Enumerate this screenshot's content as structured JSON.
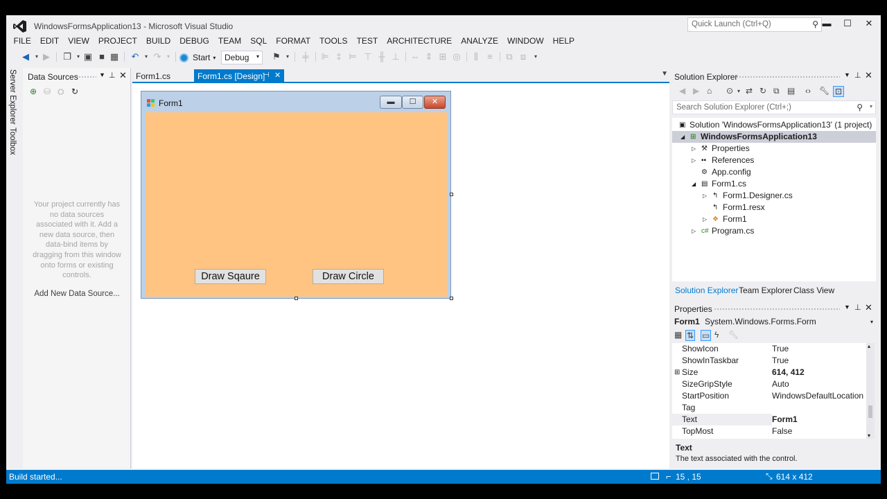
{
  "window": {
    "title": "WindowsFormsApplication13 - Microsoft Visual Studio",
    "quick_launch_placeholder": "Quick Launch (Ctrl+Q)",
    "minimize": "▬",
    "maximize": "☐",
    "close": "✕"
  },
  "menu": [
    "FILE",
    "EDIT",
    "VIEW",
    "PROJECT",
    "BUILD",
    "DEBUG",
    "TEAM",
    "SQL",
    "FORMAT",
    "TOOLS",
    "TEST",
    "ARCHITECTURE",
    "ANALYZE",
    "WINDOW",
    "HELP"
  ],
  "toolbar": {
    "start_label": "Start",
    "config_value": "Debug"
  },
  "left_strip": {
    "server_explorer": "Server Explorer",
    "toolbox": "Toolbox"
  },
  "data_sources": {
    "title": "Data Sources",
    "empty_message": "Your project currently has no data sources associated with it. Add a new data source, then data-bind items by dragging from this window onto forms or existing controls.",
    "add_link": "Add New Data Source..."
  },
  "doc_tabs": {
    "tab1": "Form1.cs",
    "tab2": "Form1.cs [Design]"
  },
  "form": {
    "title": "Form1",
    "button1": "Draw Sqaure",
    "button2": "Draw Circle",
    "back_color": "#ffc482"
  },
  "solution_explorer": {
    "title": "Solution Explorer",
    "search_placeholder": "Search Solution Explorer (Ctrl+;)",
    "tree": [
      {
        "label": "Solution 'WindowsFormsApplication13' (1 project)",
        "icon": "solution-icon"
      },
      {
        "label": "WindowsFormsApplication13",
        "icon": "csharp-project-icon"
      },
      {
        "label": "Properties",
        "icon": "wrench-icon"
      },
      {
        "label": "References",
        "icon": "references-icon"
      },
      {
        "label": "App.config",
        "icon": "config-file-icon"
      },
      {
        "label": "Form1.cs",
        "icon": "form-file-icon"
      },
      {
        "label": "Form1.Designer.cs",
        "icon": "cs-file-icon"
      },
      {
        "label": "Form1.resx",
        "icon": "resx-file-icon"
      },
      {
        "label": "Form1",
        "icon": "class-icon"
      },
      {
        "label": "Program.cs",
        "icon": "cs-file-icon"
      }
    ],
    "tabs": [
      "Solution Explorer",
      "Team Explorer",
      "Class View"
    ]
  },
  "properties": {
    "title": "Properties",
    "object_name": "Form1",
    "object_type": "System.Windows.Forms.Form",
    "rows": [
      {
        "name": "ShowIcon",
        "value": "True"
      },
      {
        "name": "ShowInTaskbar",
        "value": "True"
      },
      {
        "name": "Size",
        "value": "614, 412"
      },
      {
        "name": "SizeGripStyle",
        "value": "Auto"
      },
      {
        "name": "StartPosition",
        "value": "WindowsDefaultLocation"
      },
      {
        "name": "Tag",
        "value": ""
      },
      {
        "name": "Text",
        "value": "Form1"
      },
      {
        "name": "TopMost",
        "value": "False"
      }
    ],
    "desc_title": "Text",
    "desc_text": "The text associated with the control."
  },
  "status": {
    "text": "Build started...",
    "position": "15 , 15",
    "size": "614 x 412"
  },
  "colors": {
    "accent": "#007acc",
    "form_back": "#ffc482"
  }
}
